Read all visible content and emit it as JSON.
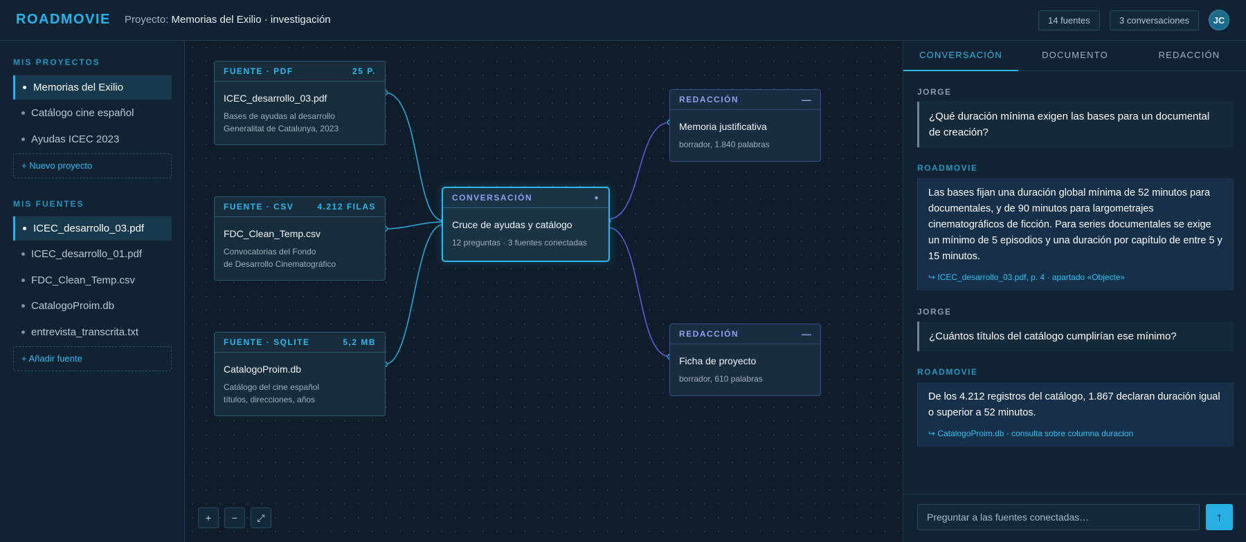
{
  "header": {
    "brand": "ROADMOVIE",
    "project_prefix": "Proyecto:",
    "project_name": "Memorias del Exilio · investigación",
    "sources_pill": "14 fuentes",
    "conversations_pill": "3 conversaciones",
    "avatar_initials": "JC"
  },
  "sidebar": {
    "projects_heading": "MIS PROYECTOS",
    "projects": [
      {
        "label": "Memorias del Exilio",
        "active": true
      },
      {
        "label": "Catálogo cine español",
        "active": false
      },
      {
        "label": "Ayudas ICEC 2023",
        "active": false
      }
    ],
    "new_project": "+ Nuevo proyecto",
    "sources_heading": "MIS FUENTES",
    "sources": [
      {
        "label": "ICEC_desarrollo_03.pdf",
        "active": true
      },
      {
        "label": "ICEC_desarrollo_01.pdf",
        "active": false
      },
      {
        "label": "FDC_Clean_Temp.csv",
        "active": false
      },
      {
        "label": "CatalogoProim.db",
        "active": false
      },
      {
        "label": "entrevista_transcrita.txt",
        "active": false
      }
    ],
    "add_source": "+ Añadir fuente"
  },
  "canvas": {
    "nodes": {
      "pdf": {
        "kind": "FUENTE · PDF",
        "meta": "25 P.",
        "title": "ICEC_desarrollo_03.pdf",
        "desc1": "Bases de ayudas al desarrollo",
        "desc2": "Generalitat de Catalunya, 2023"
      },
      "csv": {
        "kind": "FUENTE · CSV",
        "meta": "4.212 FILAS",
        "title": "FDC_Clean_Temp.csv",
        "desc1": "Convocatorias del Fondo",
        "desc2": "de Desarrollo Cinematográfico"
      },
      "db": {
        "kind": "FUENTE · SQLITE",
        "meta": "5,2 MB",
        "title": "CatalogoProim.db",
        "desc1": "Catálogo del cine español",
        "desc2": "títulos, direcciones, años"
      },
      "conv": {
        "kind": "CONVERSACIÓN",
        "meta": "●",
        "title": "Cruce de ayudas y catálogo",
        "desc1": "12 preguntas · 3 fuentes conectadas"
      },
      "draft1": {
        "kind": "REDACCIÓN",
        "meta": "—",
        "title": "Memoria justificativa",
        "desc1": "borrador, 1.840 palabras"
      },
      "draft2": {
        "kind": "REDACCIÓN",
        "meta": "—",
        "title": "Ficha de proyecto",
        "desc1": "borrador, 610 palabras"
      }
    },
    "zoom_in": "+",
    "zoom_out": "−",
    "fit": "⤢"
  },
  "panel": {
    "tabs": [
      {
        "label": "CONVERSACIÓN",
        "active": true
      },
      {
        "label": "DOCUMENTO",
        "active": false
      },
      {
        "label": "REDACCIÓN",
        "active": false
      }
    ],
    "messages": [
      {
        "author": "JORGE",
        "text": "¿Qué duración mínima exigen las bases para un documental de creación?"
      },
      {
        "author": "ROADMOVIE",
        "text": "Las bases fijan una duración global mínima de 52 minutos para documentales, y de 90 minutos para largometrajes cinematográficos de ficción. Para series documentales se exige un mínimo de 5 episodios y una duración por capítulo de entre 5 y 15 minutos.",
        "cite": "↪ ICEC_desarrollo_03.pdf, p. 4 · apartado «Objecte»"
      },
      {
        "author": "JORGE",
        "text": "¿Cuántos títulos del catálogo cumplirían ese mínimo?"
      },
      {
        "author": "ROADMOVIE",
        "text": "De los 4.212 registros del catálogo, 1.867 declaran duración igual o superior a 52 minutos.",
        "cite": "↪ CatalogoProim.db · consulta sobre columna duracion"
      }
    ],
    "composer_placeholder": "Preguntar a las fuentes conectadas…",
    "send_icon": "↑"
  },
  "colors": {
    "accent": "#27b4e8",
    "draft_accent": "#8fa0ef",
    "background": "#0f1d2a"
  }
}
